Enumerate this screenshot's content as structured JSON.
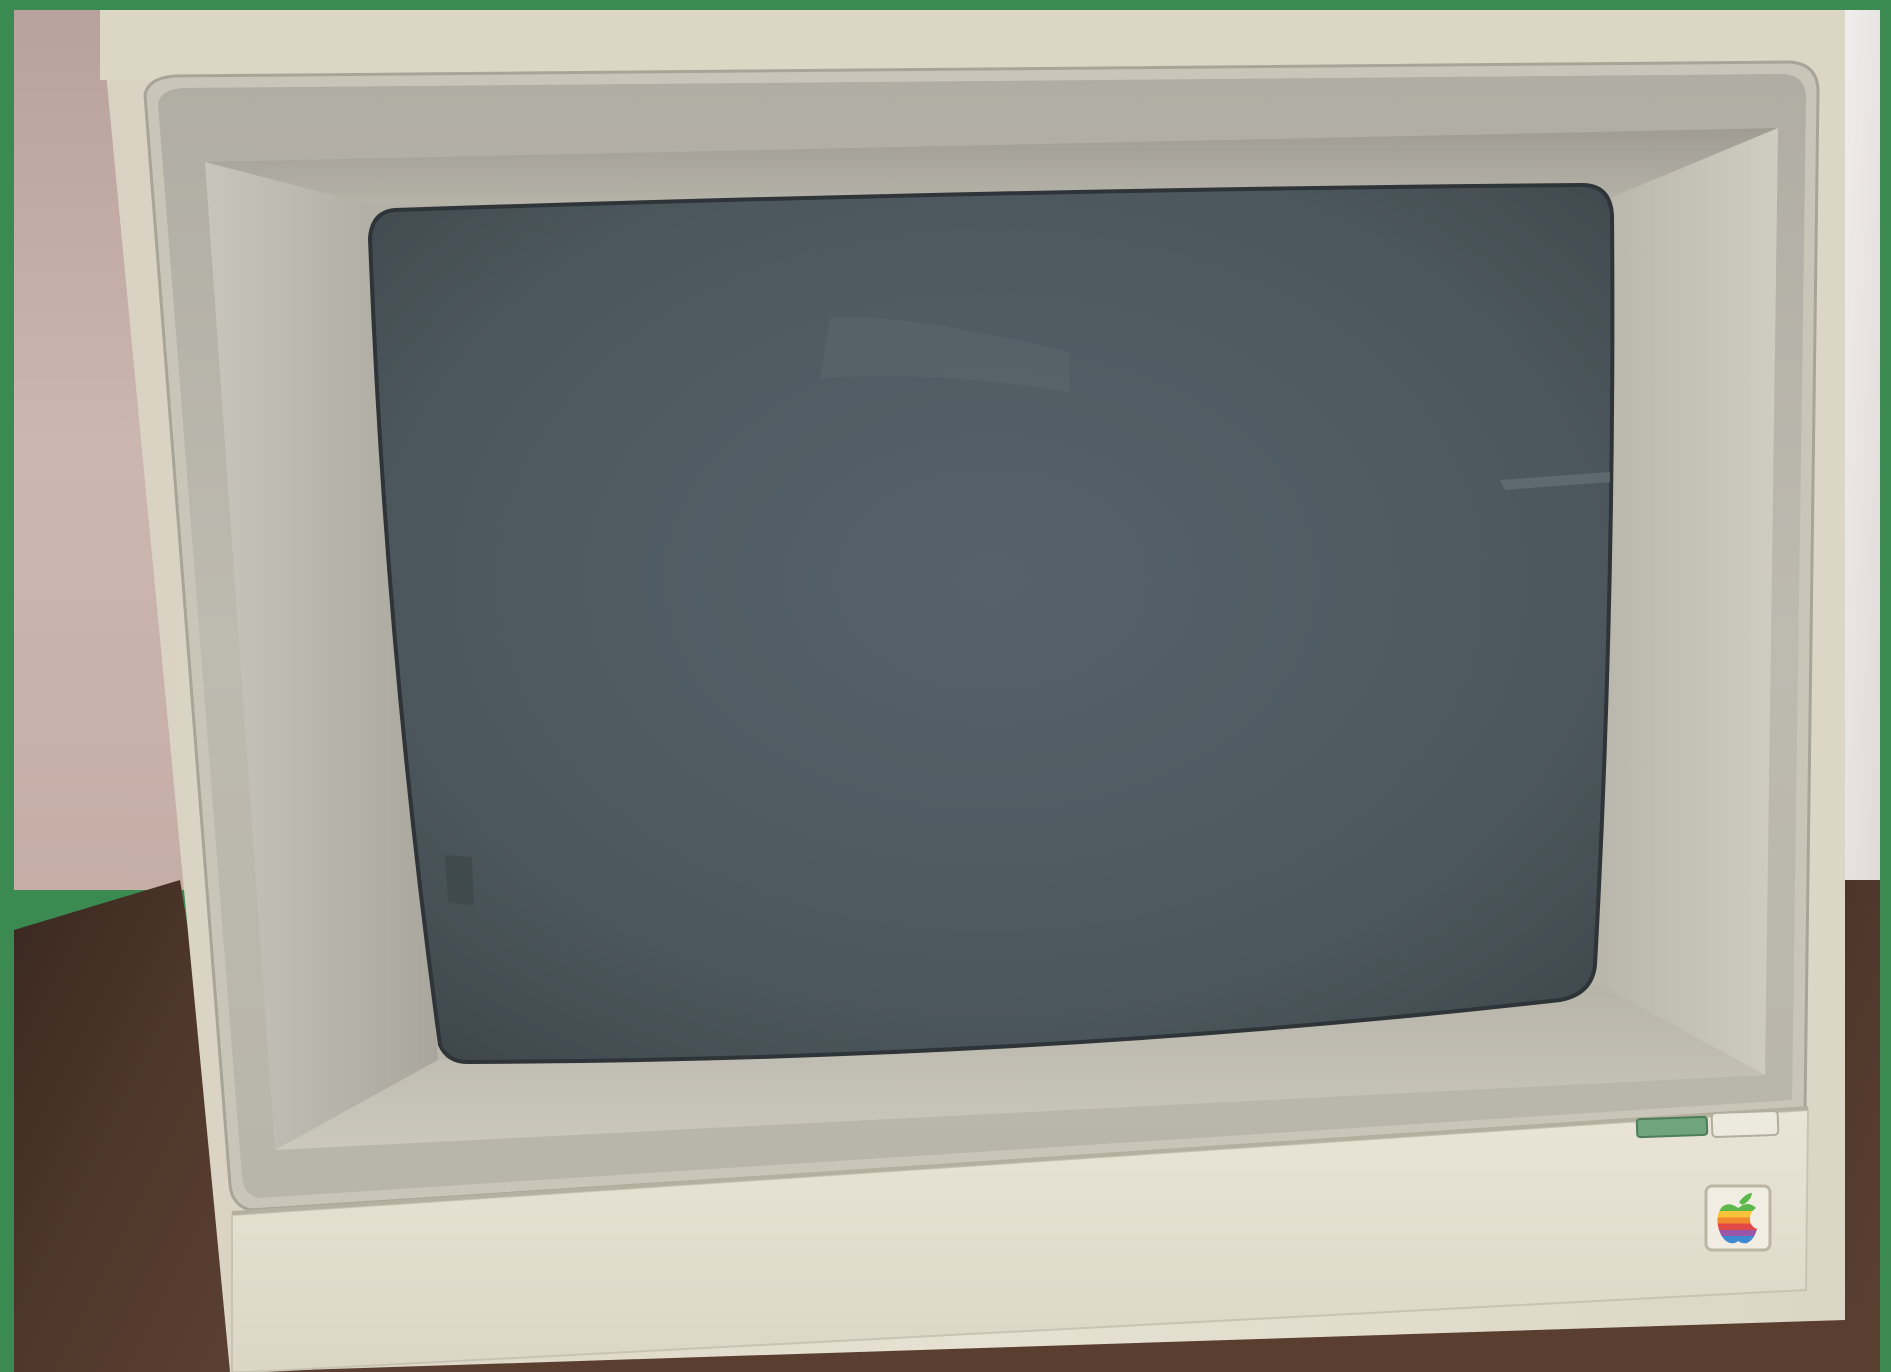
{
  "photo": {
    "subject": "",
    "colors": {
      "frame_green": "#3b8a52",
      "wall": "#cbb4ae",
      "wall_right": "#ebe6e4",
      "table": "#4a3328",
      "case_beige": "#e2dccb",
      "bezel_gray": "#bbb8ad",
      "screen": "#4f5a5f",
      "power_led": "#6fa47c",
      "power_button": "#ece9df"
    },
    "icons": {
      "logo": "rainbow-apple-logo-icon",
      "power_indicator": "power-led-icon",
      "power_switch": "power-button-icon"
    }
  }
}
